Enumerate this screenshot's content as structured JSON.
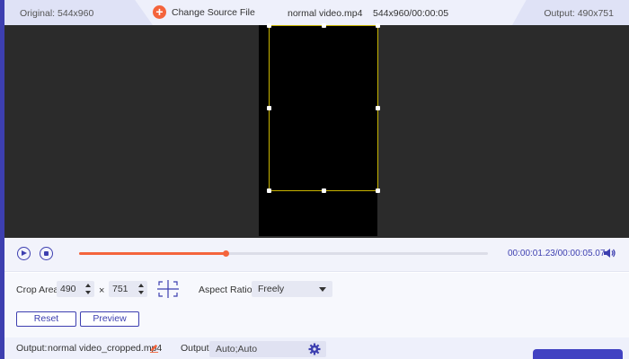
{
  "topbar": {
    "original_label": "Original: 544x960",
    "change_source_label": "Change Source File",
    "filename": "normal video.mp4",
    "file_info": "544x960/00:00:05",
    "output_label": "Output: 490x751"
  },
  "playback": {
    "current_time": "00:00:01.23",
    "total_time": "/00:00:05.07",
    "progress": 0.36
  },
  "crop": {
    "label": "Crop Area:",
    "width": "490",
    "times": "×",
    "height": "751",
    "aspect_label": "Aspect Ratio:",
    "aspect_value": "Freely",
    "reset_label": "Reset",
    "preview_label": "Preview"
  },
  "bottom": {
    "output_label": "Output:",
    "output_file": "normal video_cropped.mp4",
    "output_settings_label": "Output:",
    "output_settings_value": "Auto;Auto"
  },
  "colors": {
    "accent": "#3d3fb0",
    "orange": "#f4643c",
    "crop_border": "#c8b400"
  },
  "icons": [
    "plus-icon",
    "play-icon",
    "stop-icon",
    "volume-icon",
    "center-crop-icon",
    "pencil-icon",
    "gear-icon"
  ]
}
